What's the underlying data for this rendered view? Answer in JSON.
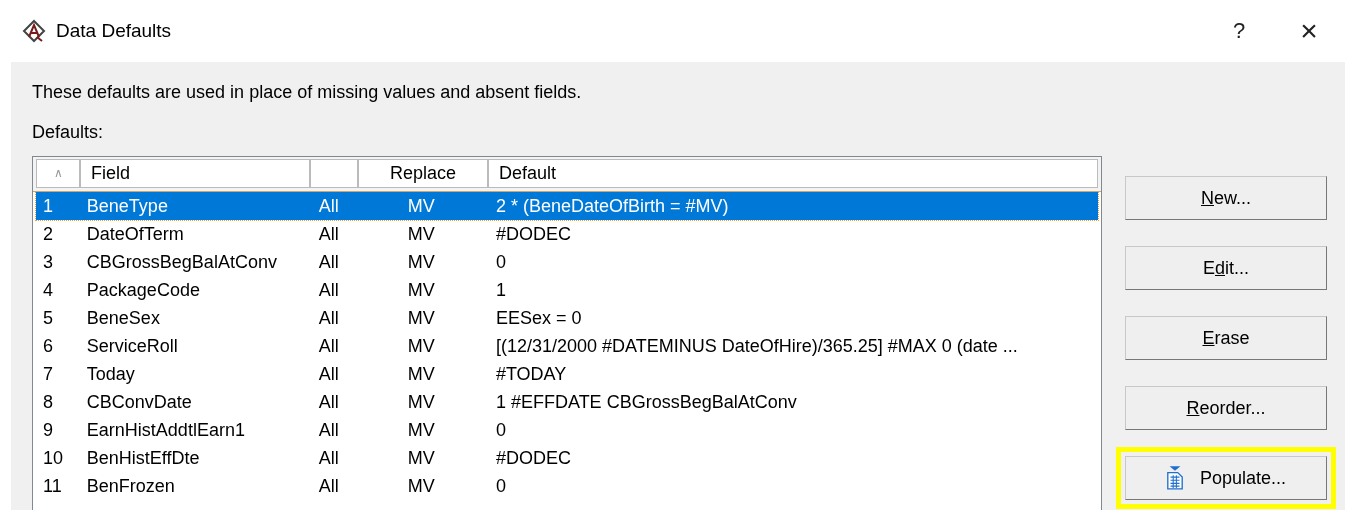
{
  "window": {
    "title": "Data Defaults",
    "help": "?",
    "close": "×"
  },
  "description": "These defaults are used in place of missing values and absent fields.",
  "list_label": "Defaults:",
  "table": {
    "sort_indicator": "∧",
    "columns": [
      "Field",
      "",
      "Replace",
      "Default"
    ],
    "rows": [
      {
        "number": "1",
        "field": "BeneType",
        "scope": "All",
        "replace": "MV",
        "default": "2 * (BeneDateOfBirth = #MV)",
        "selected": true
      },
      {
        "number": "2",
        "field": "DateOfTerm",
        "scope": "All",
        "replace": "MV",
        "default": "#DODEC",
        "selected": false
      },
      {
        "number": "3",
        "field": "CBGrossBegBalAtConv",
        "scope": "All",
        "replace": "MV",
        "default": "0",
        "selected": false
      },
      {
        "number": "4",
        "field": "PackageCode",
        "scope": "All",
        "replace": "MV",
        "default": "1",
        "selected": false
      },
      {
        "number": "5",
        "field": "BeneSex",
        "scope": "All",
        "replace": "MV",
        "default": "EESex = 0",
        "selected": false
      },
      {
        "number": "6",
        "field": "ServiceRoll",
        "scope": "All",
        "replace": "MV",
        "default": "[(12/31/2000 #DATEMINUS DateOfHire)/365.25] #MAX 0 (date ...",
        "selected": false
      },
      {
        "number": "7",
        "field": "Today",
        "scope": "All",
        "replace": "MV",
        "default": "#TODAY",
        "selected": false
      },
      {
        "number": "8",
        "field": "CBConvDate",
        "scope": "All",
        "replace": "MV",
        "default": "1 #EFFDATE CBGrossBegBalAtConv",
        "selected": false
      },
      {
        "number": "9",
        "field": "EarnHistAddtlEarn1",
        "scope": "All",
        "replace": "MV",
        "default": "0",
        "selected": false
      },
      {
        "number": "10",
        "field": "BenHistEffDte",
        "scope": "All",
        "replace": "MV",
        "default": "#DODEC",
        "selected": false
      },
      {
        "number": "11",
        "field": "BenFrozen",
        "scope": "All",
        "replace": "MV",
        "default": "0",
        "selected": false
      }
    ]
  },
  "buttons": [
    {
      "kind": "text",
      "key": "N",
      "post": "ew...",
      "highlighted": false
    },
    {
      "kind": "text",
      "pre": "E",
      "key": "d",
      "post": "it...",
      "highlighted": false
    },
    {
      "kind": "text",
      "key": "E",
      "post": "rase",
      "highlighted": false
    },
    {
      "kind": "text",
      "key": "R",
      "post": "eorder...",
      "highlighted": false
    },
    {
      "kind": "icon",
      "pre": "Populate...",
      "highlighted": true
    }
  ]
}
